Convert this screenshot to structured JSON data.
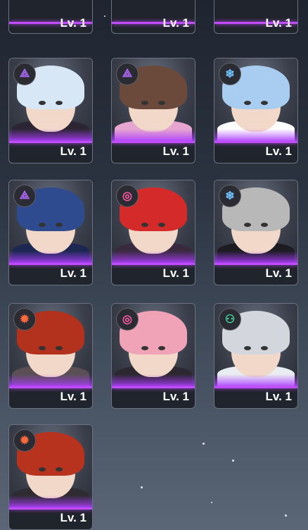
{
  "level_label": "Lv. 1",
  "cards": [
    {
      "id": "top-1",
      "level": "Lv. 1",
      "element": null
    },
    {
      "id": "top-2",
      "level": "Lv. 1",
      "element": null
    },
    {
      "id": "top-3",
      "level": "Lv. 1",
      "element": null
    },
    {
      "id": "char-1",
      "level": "Lv. 1",
      "element": "psychic",
      "element_color": "#b36bff",
      "hair": "#d7e7f5",
      "outfit": "#2c2533"
    },
    {
      "id": "char-2",
      "level": "Lv. 1",
      "element": "psychic",
      "element_color": "#b36bff",
      "hair": "#6b4a3c",
      "outfit": "#e6a6d0"
    },
    {
      "id": "char-3",
      "level": "Lv. 1",
      "element": "ice",
      "element_color": "#6fc3ff",
      "hair": "#a9cdf0",
      "outfit": "#ffffff"
    },
    {
      "id": "char-4",
      "level": "Lv. 1",
      "element": "psychic",
      "element_color": "#b36bff",
      "hair": "#2e4b8f",
      "outfit": "#1d2852"
    },
    {
      "id": "char-5",
      "level": "Lv. 1",
      "element": "vortex",
      "element_color": "#ff5aa6",
      "hair": "#d42a2a",
      "outfit": "#3a2a3f"
    },
    {
      "id": "char-6",
      "level": "Lv. 1",
      "element": "ice",
      "element_color": "#6fc3ff",
      "hair": "#b8b8b8",
      "outfit": "#1c1c22"
    },
    {
      "id": "char-7",
      "level": "Lv. 1",
      "element": "fire",
      "element_color": "#ff6a3a",
      "hair": "#b3321d",
      "outfit": "#5a4f54"
    },
    {
      "id": "char-8",
      "level": "Lv. 1",
      "element": "vortex",
      "element_color": "#ff5aa6",
      "hair": "#f0a2b6",
      "outfit": "#2c2730"
    },
    {
      "id": "char-9",
      "level": "Lv. 1",
      "element": "wind",
      "element_color": "#3fe0a1",
      "hair": "#d3d6dc",
      "outfit": "#e9ecf0"
    },
    {
      "id": "char-10",
      "level": "Lv. 1",
      "element": "fire",
      "element_color": "#ff6a3a",
      "hair": "#b8331e",
      "outfit": "#2f2b33"
    }
  ],
  "element_glyphs": {
    "psychic": "⟁",
    "ice": "❄",
    "vortex": "◎",
    "fire": "✹",
    "wind": "⚇"
  }
}
